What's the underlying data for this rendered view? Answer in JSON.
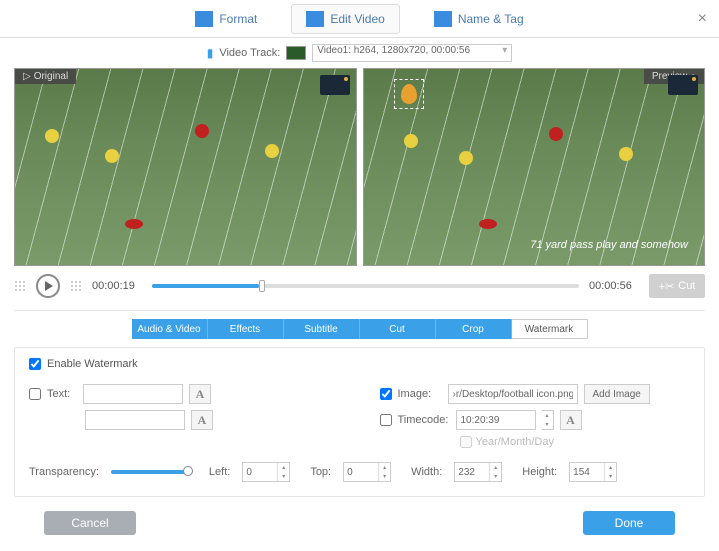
{
  "header": {
    "tabs": {
      "format": "Format",
      "edit": "Edit Video",
      "name_tag": "Name & Tag"
    }
  },
  "track": {
    "label": "Video Track:",
    "selected": "Video1: h264, 1280x720, 00:00:56"
  },
  "preview": {
    "original_label": "Original",
    "preview_label": "Preview",
    "caption": "71 yard pass play and somehow"
  },
  "playback": {
    "current": "00:00:19",
    "total": "00:00:56",
    "cut_label": "Cut"
  },
  "sub_tabs": {
    "audio_video": "Audio & Video",
    "effects": "Effects",
    "subtitle": "Subtitle",
    "cut": "Cut",
    "crop": "Crop",
    "watermark": "Watermark"
  },
  "watermark": {
    "enable_label": "Enable Watermark",
    "text_label": "Text:",
    "text_value": "",
    "text_value2": "",
    "image_label": "Image:",
    "image_value": "›r/Desktop/football icon.png",
    "add_image_label": "Add Image",
    "timecode_label": "Timecode:",
    "timecode_value": "10:20:39",
    "ymd_label": "Year/Month/Day",
    "transparency_label": "Transparency:",
    "left_label": "Left:",
    "left_value": "0",
    "top_label": "Top:",
    "top_value": "0",
    "width_label": "Width:",
    "width_value": "232",
    "height_label": "Height:",
    "height_value": "154",
    "font_btn": "A"
  },
  "footer": {
    "cancel": "Cancel",
    "done": "Done"
  }
}
